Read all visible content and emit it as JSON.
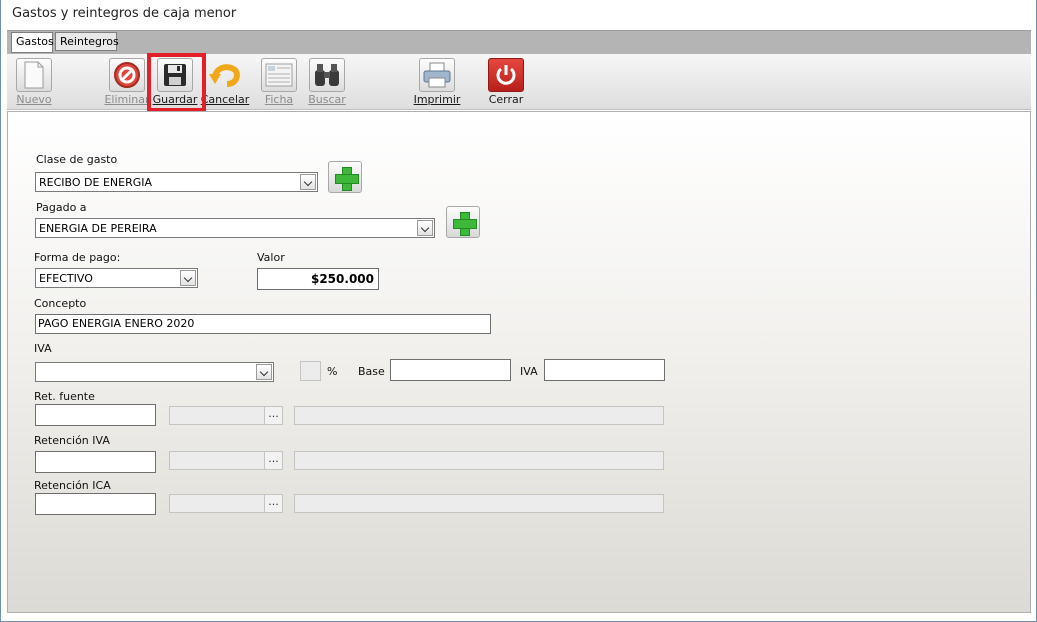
{
  "window": {
    "title": "Gastos y reintegros de caja menor"
  },
  "tabs": [
    {
      "label": "Gastos"
    },
    {
      "label": "Reintegros"
    }
  ],
  "toolbar": {
    "nuevo": "Nuevo",
    "eliminar": "Eliminar",
    "guardar": "Guardar",
    "cancelar": "Cancelar",
    "ficha": "Ficha",
    "buscar": "Buscar",
    "imprimir": "Imprimir",
    "cerrar": "Cerrar"
  },
  "form": {
    "clase_label": "Clase de gasto",
    "clase_value": "RECIBO DE ENERGIA",
    "pagado_label": "Pagado a",
    "pagado_value": "ENERGIA DE PEREIRA",
    "forma_label": "Forma de pago:",
    "forma_value": "EFECTIVO",
    "valor_label": "Valor",
    "valor_value": "$250.000",
    "concepto_label": "Concepto",
    "concepto_value": "PAGO ENERGIA ENERO 2020",
    "iva_label": "IVA",
    "iva_value": "",
    "pct_label": "%",
    "base_label": "Base",
    "base_value": "",
    "iva2_label": "IVA",
    "iva2_value": "",
    "retfuente_label": "Ret. fuente",
    "retiva_label": "Retención IVA",
    "retica_label": "Retención ICA",
    "dots": "..."
  },
  "colors": {
    "highlight": "#e3202a",
    "add_green": "#3db83a",
    "cerrar_red": "#d9302b"
  }
}
